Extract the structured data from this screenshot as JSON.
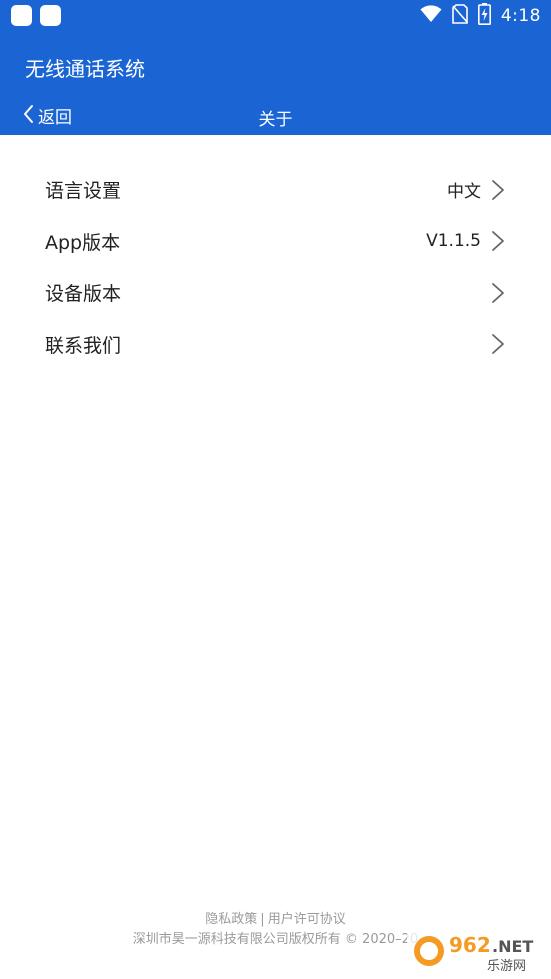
{
  "status_bar": {
    "time": "4:18",
    "icons": [
      "notification-icon",
      "notification-icon",
      "wifi-icon",
      "no-sim-icon",
      "battery-charging-icon"
    ]
  },
  "app_bar": {
    "title": "无线通话系统",
    "back_label": "返回",
    "page_title": "关于"
  },
  "settings": {
    "items": [
      {
        "label": "语言设置",
        "value": "中文"
      },
      {
        "label": "App版本",
        "value": "V1.1.5"
      },
      {
        "label": "设备版本",
        "value": ""
      },
      {
        "label": "联系我们",
        "value": ""
      }
    ]
  },
  "footer": {
    "privacy_policy": "隐私政策",
    "separator": "|",
    "user_agreement": "用户许可协议",
    "copyright": "深圳市昊一源科技有限公司版权所有 © 2020–20"
  },
  "watermark": {
    "brand": "962.NET",
    "sub": "乐游网"
  },
  "colors": {
    "primary": "#1b64d3",
    "text": "#222222",
    "muted": "#9a9a9a",
    "watermark_orange": "#f39b22"
  }
}
